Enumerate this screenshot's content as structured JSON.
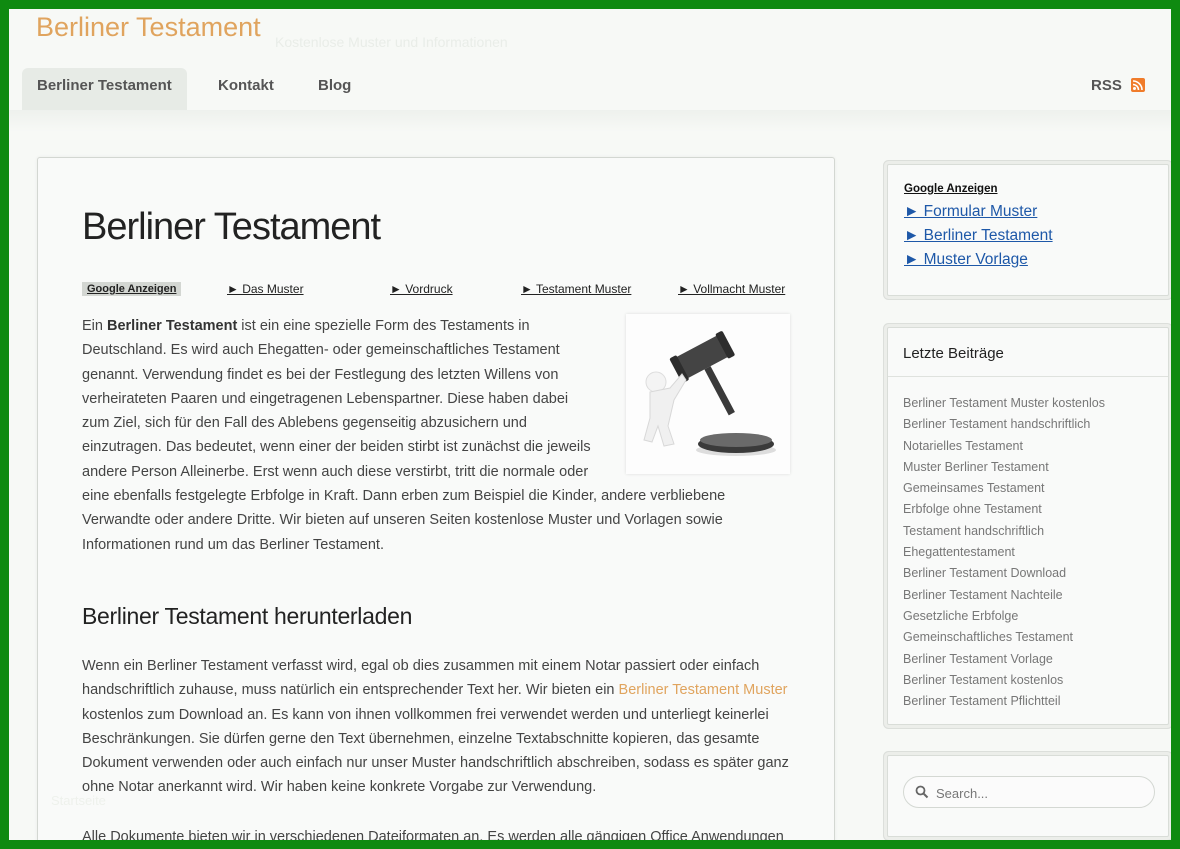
{
  "site": {
    "title": "Berliner Testament",
    "tagline": "Kostenlose Muster und Informationen",
    "footer_ghost": "Startseite"
  },
  "nav": {
    "items": [
      {
        "label": "Berliner Testament"
      },
      {
        "label": "Kontakt"
      },
      {
        "label": "Blog"
      }
    ],
    "rss_label": "RSS"
  },
  "article": {
    "title": "Berliner Testament",
    "ads": {
      "label": "Google Anzeigen",
      "links": [
        "► Das Muster",
        "► Vordruck",
        "► Testament Muster",
        "► Vollmacht Muster"
      ]
    },
    "intro": {
      "pre": "Ein ",
      "bold": "Berliner Testament",
      "post": " ist ein eine spezielle Form des Testaments in Deutschland. Es wird auch Ehegatten- oder gemeinschaftliches Testament genannt. Verwendung findet es bei der Festlegung des letzten Willens von verheirateten Paaren und eingetragenen Lebenspartner. Diese haben dabei zum Ziel, sich für den Fall des Ablebens gegenseitig abzusichern und einzutragen. Das bedeutet, wenn einer der beiden stirbt ist zunächst die jeweils andere Person Alleinerbe. Erst wenn auch diese verstirbt, tritt die normale oder eine ebenfalls festgelegte Erbfolge in Kraft. Dann erben zum Beispiel die Kinder, andere verbliebene Verwandte oder andere Dritte. Wir bieten auf unseren Seiten kostenlose Muster und Vorlagen sowie Informationen rund um das Berliner Testament."
    },
    "section_title": "Berliner Testament herunterladen",
    "para2": {
      "pre": "Wenn ein Berliner Testament verfasst wird, egal ob dies zusammen mit einem Notar passiert oder einfach handschriftlich zuhause, muss natürlich ein entsprechender Text her. Wir bieten ein ",
      "link": "Berliner Testament Muster",
      "post": " kostenlos zum Download an. Es kann von ihnen vollkommen frei verwendet werden und unterliegt keinerlei Beschränkungen. Sie dürfen gerne den Text übernehmen, einzelne Textabschnitte kopieren, das gesamte Dokument verwenden oder auch einfach nur unser Muster handschriftlich abschreiben, sodass es später ganz ohne Notar anerkannt wird. Wir haben keine konkrete Vorgabe zur Verwendung."
    },
    "para3": "Alle Dokumente bieten wir in verschiedenen Dateiformaten an. Es werden alle gängigen Office Anwendungen"
  },
  "sidebar": {
    "ads": {
      "label": "Google Anzeigen",
      "links": [
        "► Formular Muster",
        "► Berliner Testament",
        "► Muster Vorlage"
      ]
    },
    "recent": {
      "title": "Letzte Beiträge",
      "items": [
        "Berliner Testament Muster kostenlos",
        "Berliner Testament handschriftlich",
        "Notarielles Testament",
        "Muster Berliner Testament",
        "Gemeinsames Testament",
        "Erbfolge ohne Testament",
        "Testament handschriftlich",
        "Ehegattentestament",
        "Berliner Testament Download",
        "Berliner Testament Nachteile",
        "Gesetzliche Erbfolge",
        "Gemeinschaftliches Testament",
        "Berliner Testament Vorlage",
        "Berliner Testament kostenlos",
        "Berliner Testament Pflichtteil"
      ]
    },
    "search": {
      "placeholder": "Search..."
    }
  },
  "colors": {
    "frame": "#0f8a10",
    "accent": "#e0a45e",
    "link": "#1e58a8"
  }
}
